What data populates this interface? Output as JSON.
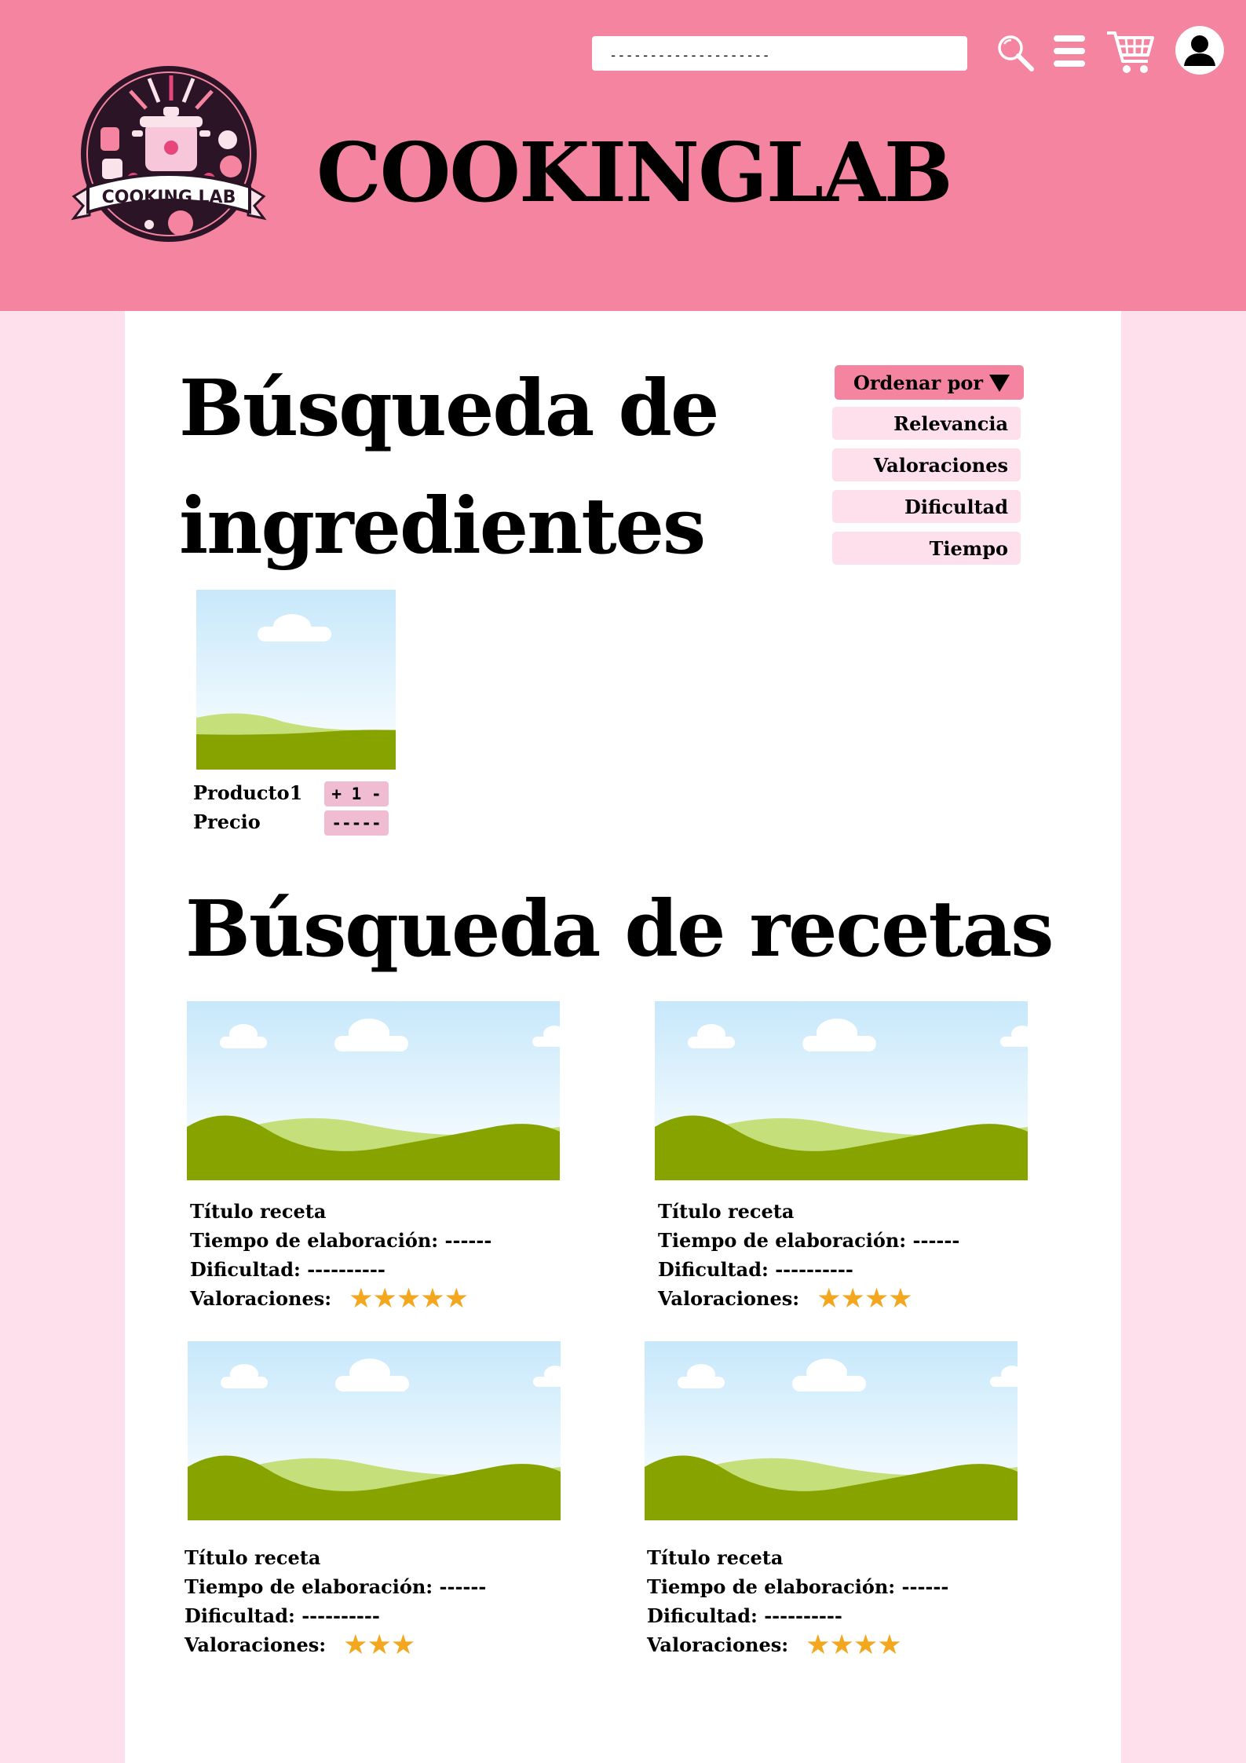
{
  "header": {
    "search": {
      "value": "--------------------"
    },
    "brand": "COOKINGLAB",
    "logo_text": "COOKING LAB",
    "icons": [
      "search-icon",
      "menu-icon",
      "cart-icon",
      "user-icon"
    ]
  },
  "ingredients": {
    "heading": "Búsqueda de ingredientes",
    "product": {
      "name": "Producto1",
      "price_label": "Precio",
      "quantity": "+ 1 -",
      "price_value": "-----"
    }
  },
  "sort": {
    "label": "Ordenar por",
    "options": [
      "Relevancia",
      "Valoraciones",
      "Dificultad",
      "Tiempo"
    ]
  },
  "recipes": {
    "heading": "Búsqueda de recetas",
    "items": [
      {
        "title": "Título receta",
        "time": "Tiempo de elaboración: ------",
        "difficulty": "Dificultad: ----------",
        "ratings_label": "Valoraciones:",
        "stars": "★★★★★",
        "rating": 5
      },
      {
        "title": "Título receta",
        "time": "Tiempo de elaboración: ------",
        "difficulty": "Dificultad: ----------",
        "ratings_label": "Valoraciones:",
        "stars": "★★★★",
        "rating": 4
      },
      {
        "title": "Título receta",
        "time": "Tiempo de elaboración: ------",
        "difficulty": "Dificultad: ----------",
        "ratings_label": "Valoraciones:",
        "stars": "★★★",
        "rating": 3
      },
      {
        "title": "Título receta",
        "time": "Tiempo de elaboración: ------",
        "difficulty": "Dificultad: ----------",
        "ratings_label": "Valoraciones:",
        "stars": "★★★★",
        "rating": 4
      }
    ]
  },
  "colors": {
    "header": "#f4849f",
    "page_background": "#fde0ec",
    "panel": "#ffffff",
    "chip": "#f0bcd2",
    "star": "#f3a71f",
    "sky": "#c7e8fb",
    "hill_dark": "#86a300",
    "hill_light": "#c5e07a"
  }
}
